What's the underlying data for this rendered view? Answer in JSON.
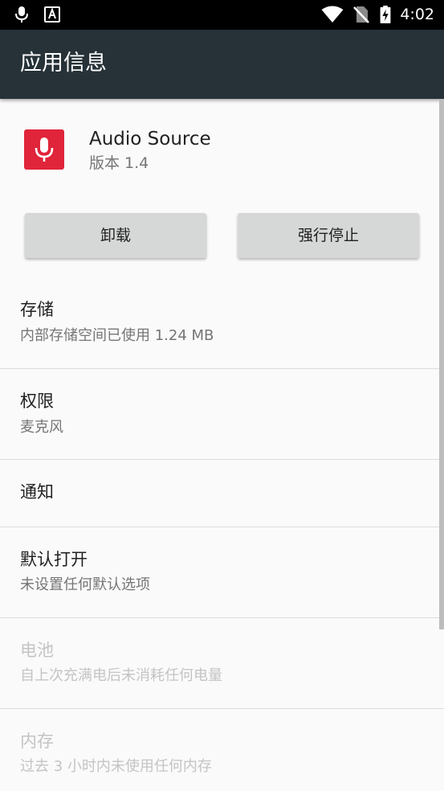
{
  "status_bar": {
    "time": "4:02",
    "icons": [
      "mic-icon",
      "font-a-icon",
      "wifi-icon",
      "no-sim-icon",
      "battery-charging-icon"
    ]
  },
  "app_bar": {
    "title": "应用信息"
  },
  "app": {
    "name": "Audio Source",
    "version": "版本 1.4",
    "icon": "microphone-icon",
    "icon_color": "#e0243a"
  },
  "buttons": {
    "uninstall": "卸载",
    "force_stop": "强行停止"
  },
  "items": [
    {
      "title": "存储",
      "summary": "内部存储空间已使用 1.24 MB",
      "enabled": true
    },
    {
      "title": "权限",
      "summary": "麦克风",
      "enabled": true
    },
    {
      "title": "通知",
      "summary": "",
      "enabled": true
    },
    {
      "title": "默认打开",
      "summary": "未设置任何默认选项",
      "enabled": true
    },
    {
      "title": "电池",
      "summary": "自上次充满电后未消耗任何电量",
      "enabled": false
    },
    {
      "title": "内存",
      "summary": "过去 3 小时内未使用任何内存",
      "enabled": false
    }
  ],
  "colors": {
    "status_bar": "#000000",
    "app_bar": "#263238",
    "background": "#fafafa",
    "button": "#d6d7d7",
    "disabled_text": "#c4c4c4"
  }
}
